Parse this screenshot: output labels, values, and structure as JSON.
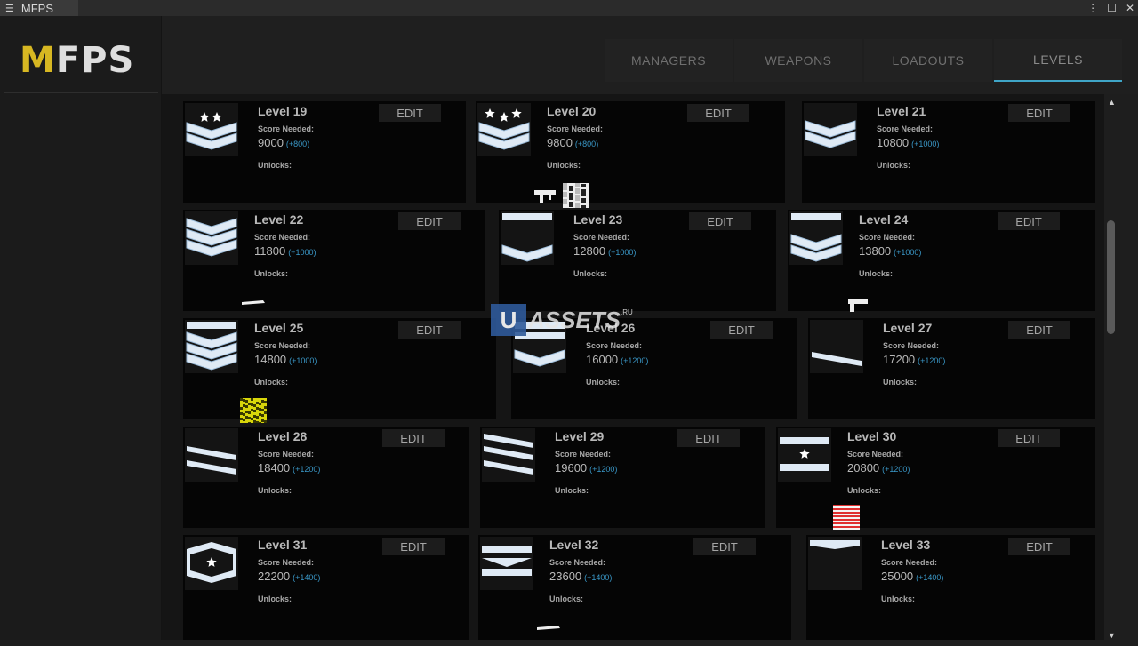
{
  "window": {
    "title": "MFPS",
    "controls": [
      "⋮",
      "☐",
      "✕"
    ]
  },
  "logo": {
    "first": "M",
    "rest": "FPS"
  },
  "tabs": [
    {
      "label": "MANAGERS"
    },
    {
      "label": "WEAPONS"
    },
    {
      "label": "LOADOUTS"
    },
    {
      "label": "LEVELS"
    }
  ],
  "labels": {
    "score_needed": "Score Needed:",
    "unlocks": "Unlocks:",
    "edit": "EDIT"
  },
  "levels": [
    {
      "title": "Level 19",
      "score": "9000",
      "inc": "(+800)",
      "badge": "chev2-star2",
      "unlocks": []
    },
    {
      "title": "Level 20",
      "score": "9800",
      "inc": "(+800)",
      "badge": "chev2-star3",
      "unlocks": [
        "weapon-rifle",
        "camo-snow"
      ]
    },
    {
      "title": "Level 21",
      "score": "10800",
      "inc": "(+1000)",
      "badge": "chev2",
      "unlocks": []
    },
    {
      "title": "Level 22",
      "score": "11800",
      "inc": "(+1000)",
      "badge": "chev3",
      "unlocks": [
        "weapon-knife"
      ]
    },
    {
      "title": "Level 23",
      "score": "12800",
      "inc": "(+1000)",
      "badge": "bar-chev1",
      "unlocks": []
    },
    {
      "title": "Level 24",
      "score": "13800",
      "inc": "(+1000)",
      "badge": "bar-chev2",
      "unlocks": [
        "weapon-pistol"
      ]
    },
    {
      "title": "Level 25",
      "score": "14800",
      "inc": "(+1000)",
      "badge": "bar-chev3",
      "unlocks": [
        "camo-yellow"
      ]
    },
    {
      "title": "Level 26",
      "score": "16000",
      "inc": "(+1200)",
      "badge": "bar2-chev1",
      "unlocks": []
    },
    {
      "title": "Level 27",
      "score": "17200",
      "inc": "(+1200)",
      "badge": "stripe1",
      "unlocks": []
    },
    {
      "title": "Level 28",
      "score": "18400",
      "inc": "(+1200)",
      "badge": "stripe2",
      "unlocks": []
    },
    {
      "title": "Level 29",
      "score": "19600",
      "inc": "(+1200)",
      "badge": "stripe3",
      "unlocks": []
    },
    {
      "title": "Level 30",
      "score": "20800",
      "inc": "(+1200)",
      "badge": "bars-star",
      "unlocks": [
        "camo-flag"
      ]
    },
    {
      "title": "Level 31",
      "score": "22200",
      "inc": "(+1400)",
      "badge": "diamond-star",
      "unlocks": []
    },
    {
      "title": "Level 32",
      "score": "23600",
      "inc": "(+1400)",
      "badge": "bar-vee",
      "unlocks": [
        "weapon-knife"
      ]
    },
    {
      "title": "Level 33",
      "score": "25000",
      "inc": "(+1400)",
      "badge": "top-vee",
      "unlocks": []
    }
  ],
  "watermark": {
    "u": "U",
    "text": "ASSETS",
    "suffix": ".RU"
  },
  "colors": {
    "accent": "#3fa5c7",
    "logo_yellow": "#d7b722",
    "increment": "#3a98c8"
  }
}
